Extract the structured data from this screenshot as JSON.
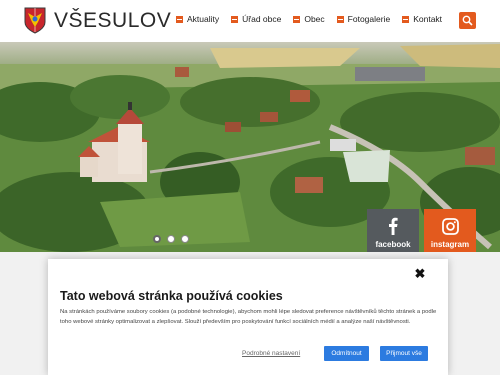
{
  "site": {
    "title": "VŠESULOV",
    "logo_icon": "coat-of-arms-icon",
    "accent_color": "#e35a1e"
  },
  "nav": {
    "items": [
      {
        "label": "Aktuality"
      },
      {
        "label": "Úřad obce"
      },
      {
        "label": "Obec"
      },
      {
        "label": "Fotogalerie"
      },
      {
        "label": "Kontakt"
      }
    ],
    "search_icon": "search-icon"
  },
  "hero": {
    "image": "aerial-village-photo",
    "slides_total": 3,
    "slide_active": 1
  },
  "social": {
    "facebook_label": "facebook",
    "instagram_label": "instagram"
  },
  "cookie": {
    "title": "Tato webová stránka používá cookies",
    "text": "Na stránkách používáme soubory cookies (a podobné technologie), abychom mohli lépe sledovat preference návštěvníků těchto stránek a podle toho webové stránky optimalizovat a zlepšovat. Slouží především pro poskytování funkcí sociálních médií a analýze naší návštěvnosti.",
    "details_link": "Podrobné nastavení",
    "reject_label": "Odmítnout",
    "accept_label": "Přijmout vše",
    "button_color": "#2c7be0"
  }
}
